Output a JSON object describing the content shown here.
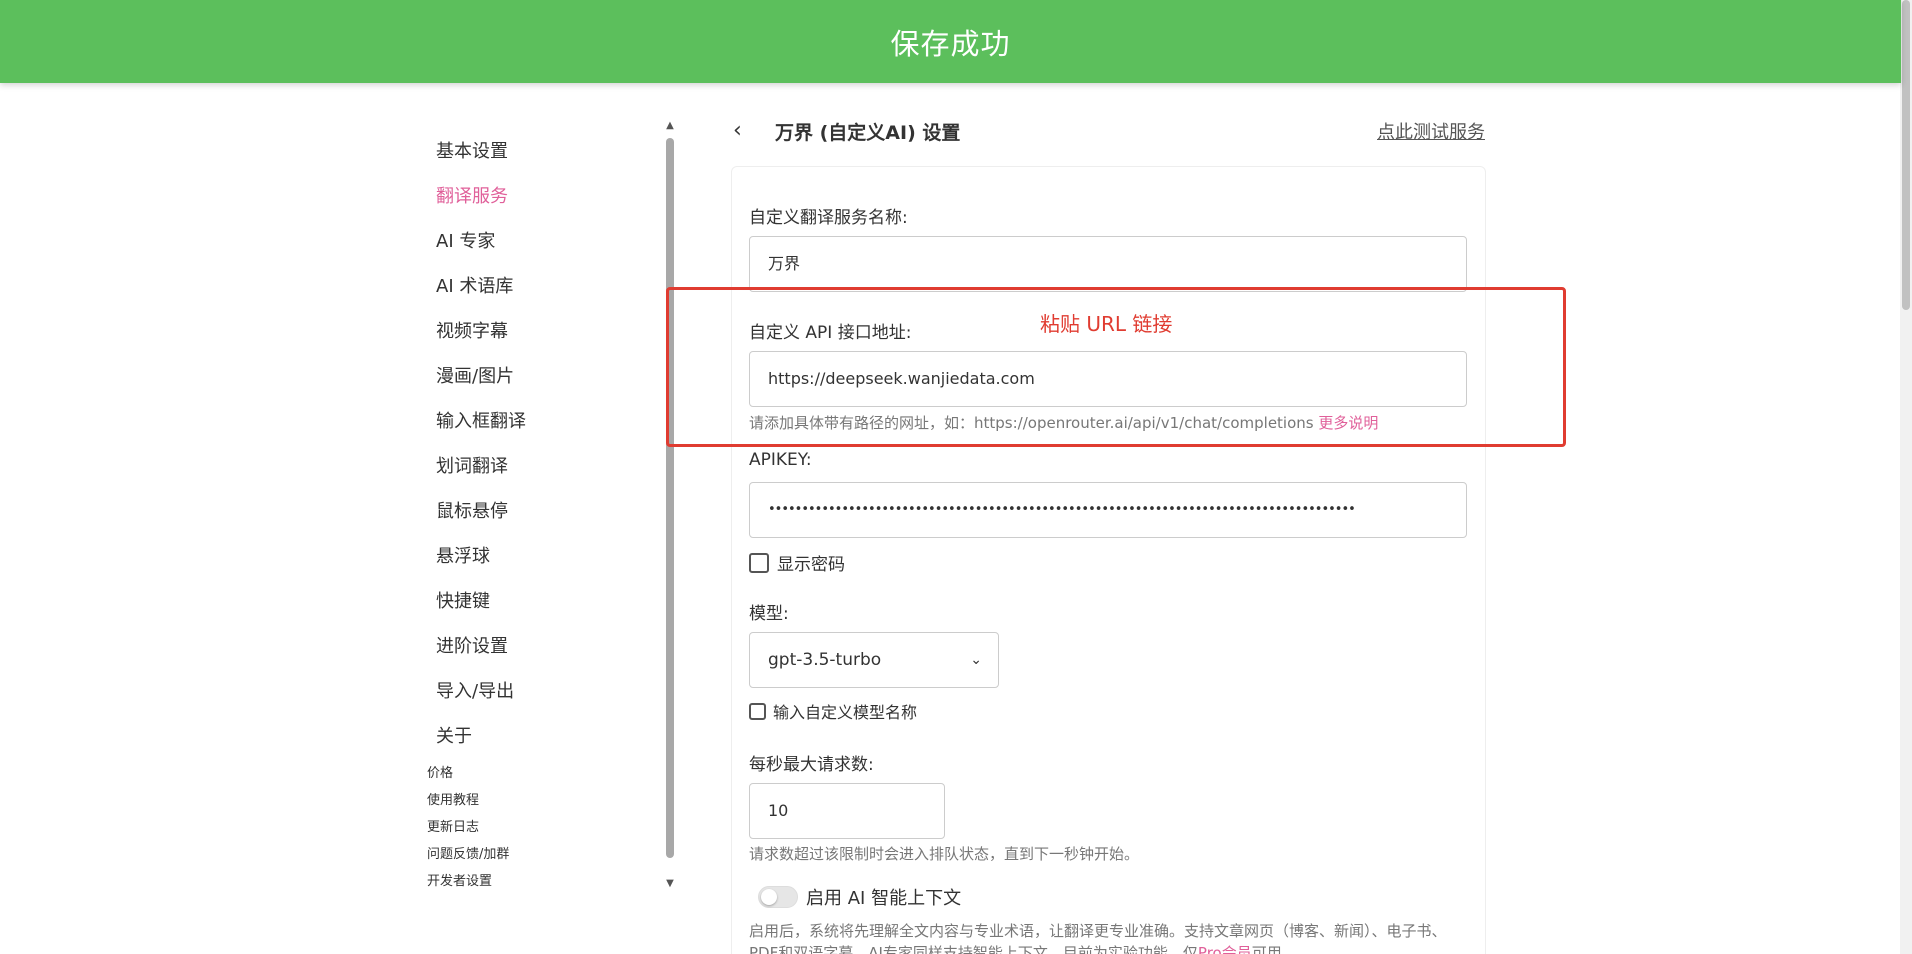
{
  "toast": {
    "message": "保存成功"
  },
  "sidebar": {
    "items": [
      {
        "label": "基本设置",
        "active": false
      },
      {
        "label": "翻译服务",
        "active": true
      },
      {
        "label": "AI 专家",
        "active": false
      },
      {
        "label": "AI 术语库",
        "active": false
      },
      {
        "label": "视频字幕",
        "active": false
      },
      {
        "label": "漫画/图片",
        "active": false
      },
      {
        "label": "输入框翻译",
        "active": false
      },
      {
        "label": "划词翻译",
        "active": false
      },
      {
        "label": "鼠标悬停",
        "active": false
      },
      {
        "label": "悬浮球",
        "active": false
      },
      {
        "label": "快捷键",
        "active": false
      },
      {
        "label": "进阶设置",
        "active": false
      },
      {
        "label": "导入/导出",
        "active": false
      },
      {
        "label": "关于",
        "active": false
      }
    ],
    "sub_items": [
      "价格",
      "使用教程",
      "更新日志",
      "问题反馈/加群",
      "开发者设置"
    ]
  },
  "header": {
    "back_icon": "chevron-left-icon",
    "title": "万界 (自定义AI) 设置",
    "test_link": "点此测试服务"
  },
  "form": {
    "service_name": {
      "label": "自定义翻译服务名称:",
      "value": "万界"
    },
    "api_url": {
      "label": "自定义 API 接口地址:",
      "value": "https://deepseek.wanjiedata.com",
      "help": "请添加具体带有路径的网址，如：https://openrouter.ai/api/v1/chat/completions",
      "help_link": "更多说明"
    },
    "apikey": {
      "label": "APIKEY:",
      "value": "••••••••••••••••••••••••••••••••••••••••••••••••••••••••••••••••••••••••••••••••••••••••"
    },
    "show_password": {
      "label": "显示密码",
      "checked": false
    },
    "model": {
      "label": "模型:",
      "selected": "gpt-3.5-turbo"
    },
    "custom_model": {
      "label": "输入自定义模型名称",
      "checked": false
    },
    "rate": {
      "label": "每秒最大请求数:",
      "value": "10",
      "help": "请求数超过该限制时会进入排队状态，直到下一秒钟开始。"
    },
    "ai_context": {
      "label": "启用 AI 智能上下文",
      "enabled": false,
      "help_prefix": "启用后，系统将先理解全文内容与专业术语，让翻译更专业准确。支持文章网页（博客、新闻）、电子书、PDF和双语字幕。AI专家同样支持智能上下文。目前为实验功能，仅",
      "help_link": "Pro会员",
      "help_suffix": "可用。"
    }
  },
  "annotation": {
    "text": "粘贴 URL 链接",
    "color": "#e03c31"
  },
  "colors": {
    "toast_bg": "#5cbf5c",
    "accent": "#e0609a"
  }
}
